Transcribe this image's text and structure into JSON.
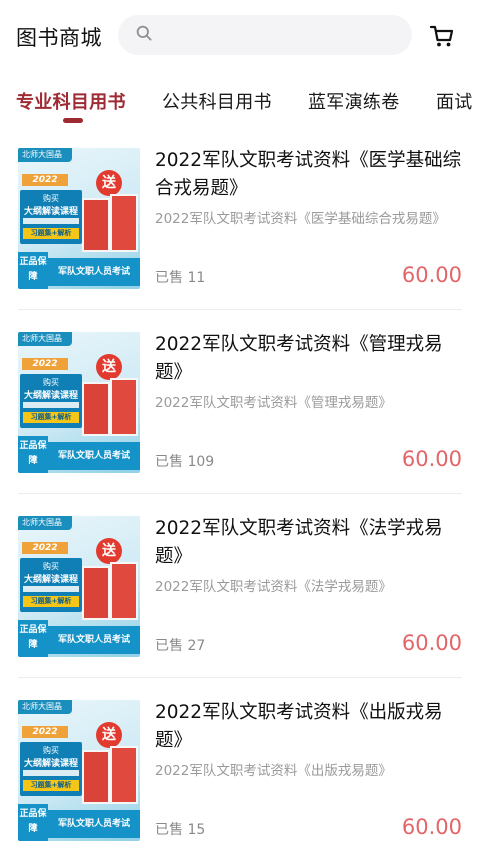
{
  "header": {
    "title": "图书商城",
    "search_placeholder": ""
  },
  "tabs": [
    {
      "label": "专业科目用书",
      "active": true
    },
    {
      "label": "公共科目用书",
      "active": false
    },
    {
      "label": "蓝军演练卷",
      "active": false
    },
    {
      "label": "面试",
      "active": false
    }
  ],
  "colors": {
    "accent": "#9e2b33",
    "price": "#e46567"
  },
  "cover": {
    "brand": "北师大国晶",
    "year": "2022",
    "panel_line1": "购买",
    "panel_line2": "大纲解读课程",
    "panel_badge": "习题集+解析",
    "gift": "送",
    "quality": "正品保障",
    "footer": "军队文职人员考试"
  },
  "products": [
    {
      "title": "2022军队文职考试资料《医学基础综合戎易题》",
      "subtitle": "2022军队文职考试资料《医学基础综合戎易题》",
      "sold_label": "已售",
      "sold": "11",
      "price": "60.00"
    },
    {
      "title": "2022军队文职考试资料《管理戎易题》",
      "subtitle": "2022军队文职考试资料《管理戎易题》",
      "sold_label": "已售",
      "sold": "109",
      "price": "60.00"
    },
    {
      "title": "2022军队文职考试资料《法学戎易题》",
      "subtitle": "2022军队文职考试资料《法学戎易题》",
      "sold_label": "已售",
      "sold": "27",
      "price": "60.00"
    },
    {
      "title": " 2022军队文职考试资料《出版戎易题》",
      "subtitle": " 2022军队文职考试资料《出版戎易题》",
      "sold_label": "已售",
      "sold": "15",
      "price": "60.00"
    }
  ]
}
